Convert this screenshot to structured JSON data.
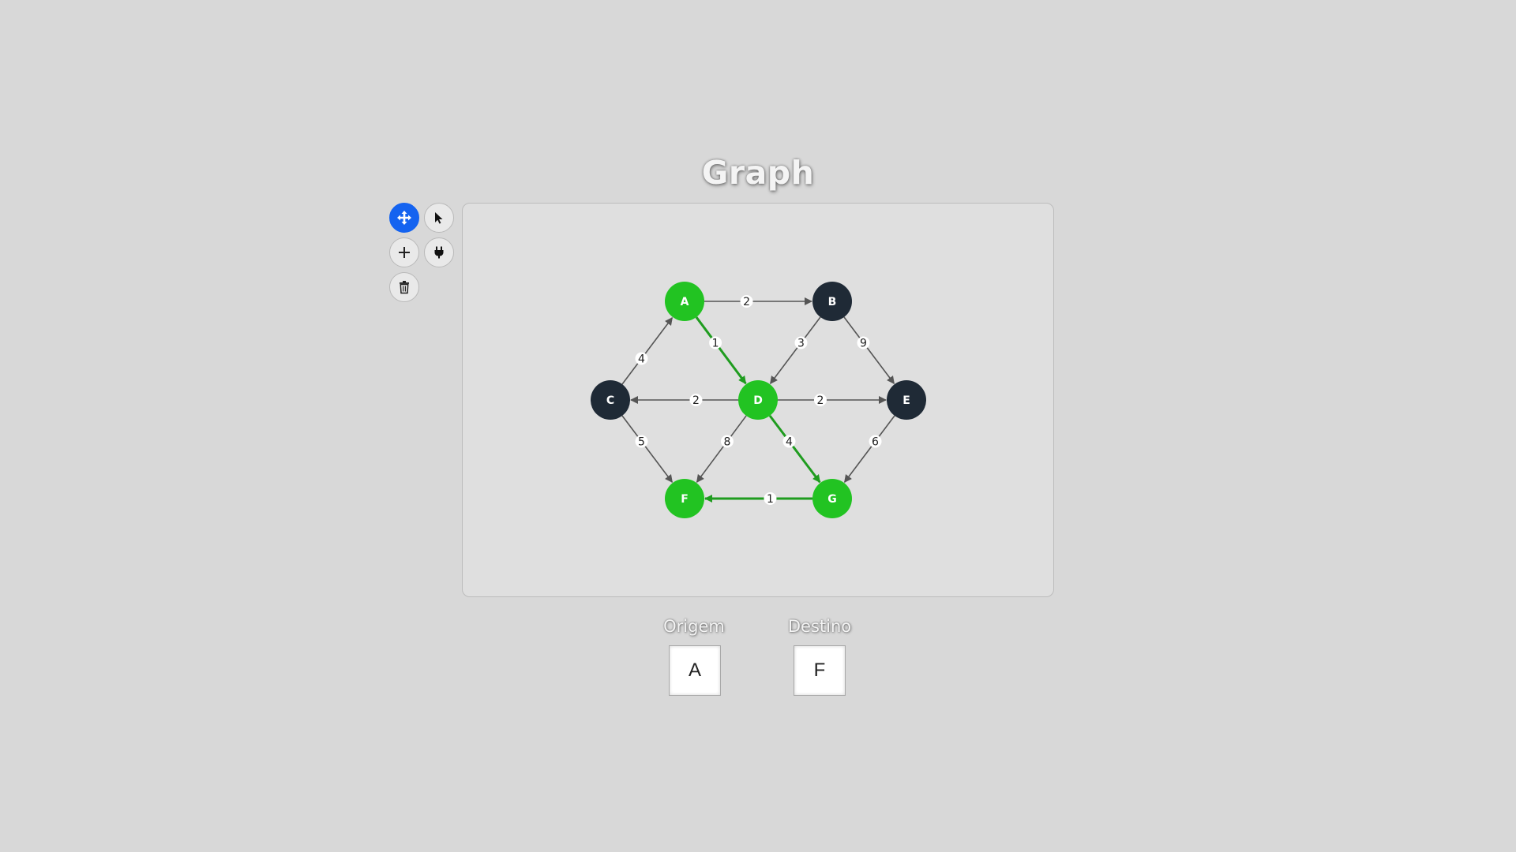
{
  "page": {
    "title": "Graph"
  },
  "toolbar": {
    "tools": [
      {
        "id": "move",
        "icon": "move-arrows-icon",
        "active": true
      },
      {
        "id": "select",
        "icon": "cursor-pointer-icon",
        "active": false
      },
      {
        "id": "add-node",
        "icon": "plus-icon",
        "active": false
      },
      {
        "id": "connect",
        "icon": "plug-icon",
        "active": false
      },
      {
        "id": "delete",
        "icon": "trash-icon",
        "active": false
      }
    ]
  },
  "colors": {
    "active_tool": "#1463f0",
    "node_default": "#1f2a36",
    "node_path": "#22c322",
    "edge_default": "#555555",
    "edge_path": "#1f9c1f"
  },
  "graph": {
    "nodes": [
      {
        "id": "A",
        "label": "A",
        "on_path": true
      },
      {
        "id": "B",
        "label": "B",
        "on_path": false
      },
      {
        "id": "C",
        "label": "C",
        "on_path": false
      },
      {
        "id": "D",
        "label": "D",
        "on_path": true
      },
      {
        "id": "E",
        "label": "E",
        "on_path": false
      },
      {
        "id": "F",
        "label": "F",
        "on_path": true
      },
      {
        "id": "G",
        "label": "G",
        "on_path": true
      }
    ],
    "edges": [
      {
        "from": "A",
        "to": "B",
        "weight": "2",
        "on_path": false
      },
      {
        "from": "A",
        "to": "D",
        "weight": "1",
        "on_path": true
      },
      {
        "from": "B",
        "to": "D",
        "weight": "3",
        "on_path": false
      },
      {
        "from": "B",
        "to": "E",
        "weight": "9",
        "on_path": false
      },
      {
        "from": "C",
        "to": "A",
        "weight": "4",
        "on_path": false
      },
      {
        "from": "D",
        "to": "C",
        "weight": "2",
        "on_path": false
      },
      {
        "from": "D",
        "to": "E",
        "weight": "2",
        "on_path": false
      },
      {
        "from": "C",
        "to": "F",
        "weight": "5",
        "on_path": false
      },
      {
        "from": "D",
        "to": "F",
        "weight": "8",
        "on_path": false
      },
      {
        "from": "D",
        "to": "G",
        "weight": "4",
        "on_path": true
      },
      {
        "from": "E",
        "to": "G",
        "weight": "6",
        "on_path": false
      },
      {
        "from": "G",
        "to": "F",
        "weight": "1",
        "on_path": true
      }
    ]
  },
  "route": {
    "origin_label": "Origem",
    "origin_value": "A",
    "destination_label": "Destino",
    "destination_value": "F"
  }
}
